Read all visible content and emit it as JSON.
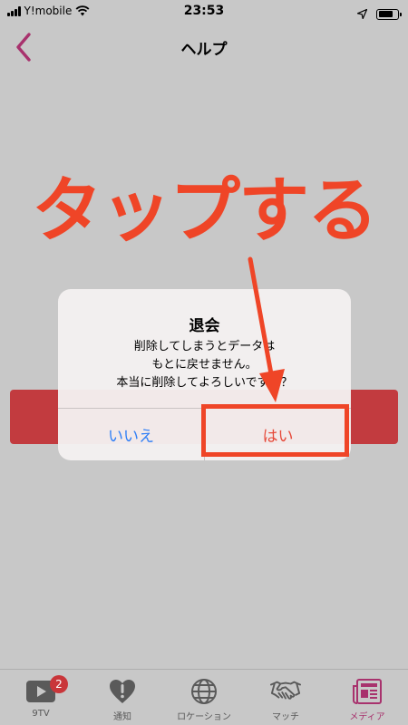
{
  "status_bar": {
    "carrier": "Y!mobile",
    "time": "23:53",
    "battery_level": 0.75
  },
  "nav": {
    "title": "ヘルプ",
    "back_icon": "chevron-left-icon",
    "accent_color": "#a8326d"
  },
  "annotation": {
    "text": "タップする",
    "color": "#ef4527"
  },
  "dialog": {
    "title": "退会",
    "message_lines": [
      "削除してしまうとデータは",
      "もとに戻せません。",
      "本当に削除してよろしいですか？"
    ],
    "cancel_label": "いいえ",
    "confirm_label": "はい",
    "cancel_color": "#2f7ff6",
    "confirm_color": "#e64a3a"
  },
  "tabs": [
    {
      "label": "9TV",
      "icon": "play-icon",
      "badge": "2",
      "active": false
    },
    {
      "label": "通知",
      "icon": "heart-alert-icon",
      "badge": null,
      "active": false
    },
    {
      "label": "ロケーション",
      "icon": "globe-icon",
      "badge": null,
      "active": false
    },
    {
      "label": "マッチ",
      "icon": "handshake-icon",
      "badge": null,
      "active": false
    },
    {
      "label": "メディア",
      "icon": "newspaper-icon",
      "badge": null,
      "active": true
    }
  ]
}
